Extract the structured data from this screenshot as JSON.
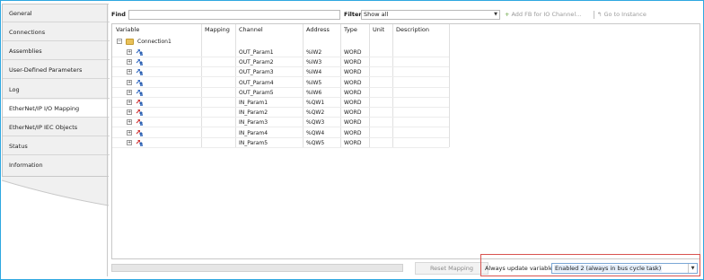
{
  "sidebar": {
    "items": [
      {
        "label": "General"
      },
      {
        "label": "Connections"
      },
      {
        "label": "Assemblies"
      },
      {
        "label": "User-Defined Parameters"
      },
      {
        "label": "Log"
      },
      {
        "label": "EtherNet/IP I/O Mapping"
      },
      {
        "label": "EtherNet/IP IEC Objects"
      },
      {
        "label": "Status"
      },
      {
        "label": "Information"
      }
    ],
    "active_index": 5
  },
  "toolbar": {
    "find_label": "Find",
    "find_value": "",
    "filter_label": "Filter",
    "filter_value": "Show all",
    "add_fb_label": "Add FB for IO Channel...",
    "goto_label": "Go to Instance"
  },
  "grid": {
    "columns": [
      "Variable",
      "Mapping",
      "Channel",
      "Address",
      "Type",
      "Unit",
      "Description"
    ],
    "group": {
      "label": "Connection1",
      "expander": "⊟"
    },
    "rows": [
      {
        "expander": "+",
        "direction": "input",
        "mapping": "",
        "channel": "OUT_Param1",
        "address": "%IW2",
        "type": "WORD",
        "unit": "",
        "description": ""
      },
      {
        "expander": "+",
        "direction": "input",
        "mapping": "",
        "channel": "OUT_Param2",
        "address": "%IW3",
        "type": "WORD",
        "unit": "",
        "description": ""
      },
      {
        "expander": "+",
        "direction": "input",
        "mapping": "",
        "channel": "OUT_Param3",
        "address": "%IW4",
        "type": "WORD",
        "unit": "",
        "description": ""
      },
      {
        "expander": "+",
        "direction": "input",
        "mapping": "",
        "channel": "OUT_Param4",
        "address": "%IW5",
        "type": "WORD",
        "unit": "",
        "description": ""
      },
      {
        "expander": "+",
        "direction": "input",
        "mapping": "",
        "channel": "OUT_Param5",
        "address": "%IW6",
        "type": "WORD",
        "unit": "",
        "description": ""
      },
      {
        "expander": "+",
        "direction": "output",
        "mapping": "",
        "channel": "IN_Param1",
        "address": "%QW1",
        "type": "WORD",
        "unit": "",
        "description": ""
      },
      {
        "expander": "+",
        "direction": "output",
        "mapping": "",
        "channel": "IN_Param2",
        "address": "%QW2",
        "type": "WORD",
        "unit": "",
        "description": ""
      },
      {
        "expander": "+",
        "direction": "output",
        "mapping": "",
        "channel": "IN_Param3",
        "address": "%QW3",
        "type": "WORD",
        "unit": "",
        "description": ""
      },
      {
        "expander": "+",
        "direction": "output",
        "mapping": "",
        "channel": "IN_Param4",
        "address": "%QW4",
        "type": "WORD",
        "unit": "",
        "description": ""
      },
      {
        "expander": "+",
        "direction": "output",
        "mapping": "",
        "channel": "IN_Param5",
        "address": "%QW5",
        "type": "WORD",
        "unit": "",
        "description": ""
      }
    ]
  },
  "bottom": {
    "reset_label": "Reset Mapping",
    "always_update_label": "Always update variables",
    "always_update_value": "Enabled 2 (always in bus cycle task)"
  },
  "colors": {
    "frame_border": "#2ea7e0",
    "highlight_border": "#d9534f",
    "input_var_arrow": "#3b6fc4",
    "output_var_arrow": "#d23b3b",
    "folder": "#e9c15a"
  }
}
